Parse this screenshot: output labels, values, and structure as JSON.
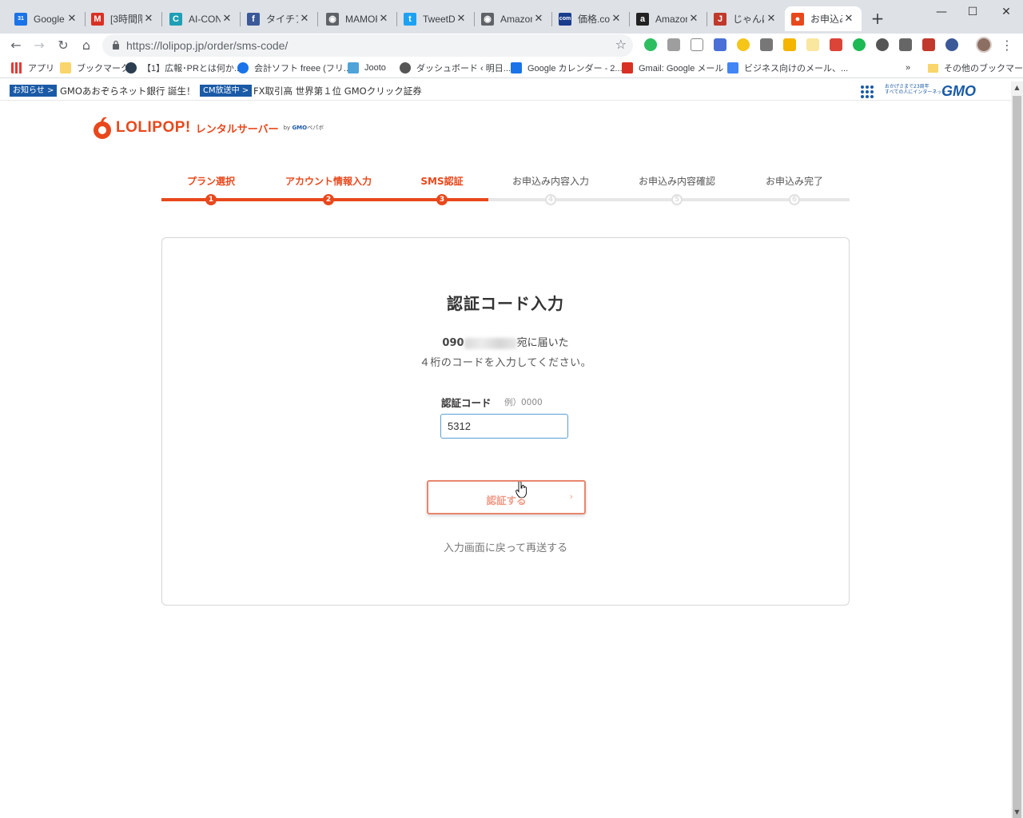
{
  "browser": {
    "tabs": [
      {
        "title": "Google",
        "icon": "google-calendar-icon",
        "color": "#1a73e8",
        "glyph": "31"
      },
      {
        "title": "[3時間限",
        "icon": "gmail-icon",
        "color": "#d93025",
        "glyph": "M"
      },
      {
        "title": "AI-CON",
        "icon": "aicon-icon",
        "color": "#1e9fb5",
        "glyph": "C"
      },
      {
        "title": "タイチアカ",
        "icon": "facebook-icon",
        "color": "#3b5998",
        "glyph": "f"
      },
      {
        "title": "MAMOR",
        "icon": "globe-icon",
        "color": "#5f6368",
        "glyph": "◉"
      },
      {
        "title": "TweetDe",
        "icon": "twitter-icon",
        "color": "#1da1f2",
        "glyph": "t"
      },
      {
        "title": "Amazon",
        "icon": "globe-icon",
        "color": "#5f6368",
        "glyph": "◉"
      },
      {
        "title": "価格.com",
        "icon": "kakaku-icon",
        "color": "#1a3c8c",
        "glyph": "com"
      },
      {
        "title": "Amazon",
        "icon": "amazon-icon",
        "color": "#222",
        "glyph": "a"
      },
      {
        "title": "じゃんぱら",
        "icon": "janpara-icon",
        "color": "#c0392b",
        "glyph": "J"
      },
      {
        "title": "お申込み",
        "icon": "lolipop-icon",
        "color": "#e8481c",
        "glyph": "●"
      }
    ],
    "url": "https://lolipop.jp/order/sms-code/",
    "bookmarks": [
      {
        "label": "アプリ",
        "icon": "apps-grid-icon"
      },
      {
        "label": "ブックマーク",
        "icon": "folder-icon"
      },
      {
        "label": "【1】広報･PRとは何か...",
        "icon": "graduation-cap-icon"
      },
      {
        "label": "会計ソフト freee (フリ...",
        "icon": "freee-icon"
      },
      {
        "label": "Jooto",
        "icon": "jooto-icon"
      },
      {
        "label": "ダッシュボード ‹ 明日...",
        "icon": "wordpress-icon"
      },
      {
        "label": "Google カレンダー - 2...",
        "icon": "google-calendar-icon"
      },
      {
        "label": "Gmail: Google メール",
        "icon": "gmail-icon"
      },
      {
        "label": "ビジネス向けのメール、...",
        "icon": "google-g-icon"
      }
    ],
    "bookmarks_overflow": "»",
    "other_bookmarks": "その他のブックマーク"
  },
  "gmo_bar": {
    "tag1": "お知らせ >",
    "text1": "GMOあおぞらネット銀行 誕生！",
    "tag2": "CM放送中 >",
    "text2": "FX取引高 世界第１位 GMOクリック証券",
    "tagline_line1": "おかげさまで23周年",
    "tagline_line2": "すべての人にインターネット",
    "logo": "GMO"
  },
  "page": {
    "brand": "LOLIPOP!",
    "brand_sub": "レンタルサーバー",
    "by_prefix": "by",
    "by_company": "GMO",
    "by_suffix": "ペパボ",
    "steps": [
      {
        "label": "プラン選択",
        "number": "1",
        "state": "done"
      },
      {
        "label": "アカウント情報入力",
        "number": "2",
        "state": "done"
      },
      {
        "label": "SMS認証",
        "number": "3",
        "state": "done"
      },
      {
        "label": "お申込み内容入力",
        "number": "4",
        "state": "todo"
      },
      {
        "label": "お申込み内容確認",
        "number": "5",
        "state": "todo"
      },
      {
        "label": "お申込み完了",
        "number": "6",
        "state": "todo"
      }
    ],
    "accent": "#e8481c",
    "title": "認証コード入力",
    "phone_prefix": "090",
    "msg_suffix": "宛に届いた",
    "msg2": "４桁のコードを入力してください。",
    "field_label": "認証コード",
    "field_hint": "例）0000",
    "code_value": "5312",
    "verify_label": "認証する",
    "verify_chevron": "›",
    "resend": "入力画面に戻って再送する"
  }
}
